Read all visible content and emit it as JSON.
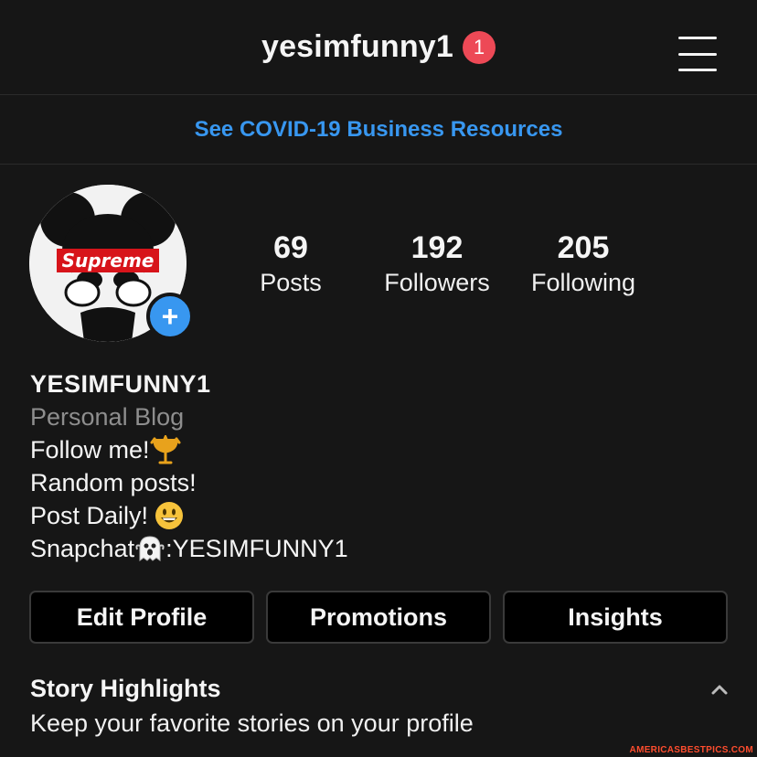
{
  "header": {
    "username": "yesimfunny1",
    "notification_count": "1"
  },
  "banner": {
    "text": "See COVID-19 Business Resources"
  },
  "avatar": {
    "logo_text": "Supreme",
    "add_icon": "+"
  },
  "stats": [
    {
      "value": "69",
      "label": "Posts"
    },
    {
      "value": "192",
      "label": "Followers"
    },
    {
      "value": "205",
      "label": "Following"
    }
  ],
  "bio": {
    "name": "YESIMFUNNY1",
    "category": "Personal Blog",
    "line1": "Follow me!",
    "line2": "Random posts!",
    "line3": "Post Daily! ",
    "line4_prefix": "Snapchat",
    "line4_suffix": ":YESIMFUNNY1"
  },
  "buttons": {
    "edit_profile": "Edit Profile",
    "promotions": "Promotions",
    "insights": "Insights"
  },
  "highlights": {
    "title": "Story Highlights",
    "subtitle": "Keep your favorite stories on your profile"
  },
  "watermark": "AMERICASBESTPICS.COM",
  "colors": {
    "accent": "#3897f0",
    "badge": "#ed4956",
    "background": "#161616"
  }
}
